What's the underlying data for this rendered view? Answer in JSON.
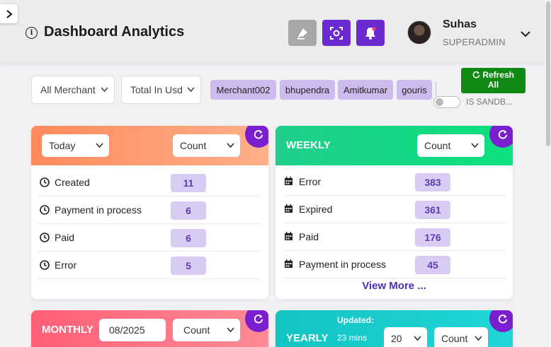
{
  "header": {
    "title": "Dashboard Analytics",
    "user_name": "Suhas",
    "user_role": "SUPERADMIN"
  },
  "filters": {
    "merchant_select": "All Merchant",
    "currency_select": "Total In Usd",
    "chips": [
      "Merchant002",
      "bhupendra",
      "Amitkumar",
      "gouris"
    ],
    "refresh_all_line1": "Refresh",
    "refresh_all_line2": "All",
    "sandbox_label": "IS SANDB..."
  },
  "cards": {
    "today": {
      "period_select": "Today",
      "metric_select": "Count",
      "rows": [
        {
          "label": "Created",
          "count": "11"
        },
        {
          "label": "Payment in process",
          "count": "6"
        },
        {
          "label": "Paid",
          "count": "6"
        },
        {
          "label": "Error",
          "count": "5"
        }
      ]
    },
    "weekly": {
      "title": "WEEKLY",
      "metric_select": "Count",
      "rows": [
        {
          "label": "Error",
          "count": "383"
        },
        {
          "label": "Expired",
          "count": "361"
        },
        {
          "label": "Paid",
          "count": "176"
        },
        {
          "label": "Payment in process",
          "count": "45"
        }
      ],
      "view_more": "View More ..."
    },
    "monthly": {
      "title": "MONTHLY",
      "month_input": "08/2025",
      "metric_select": "Count"
    },
    "yearly": {
      "title": "YEARLY",
      "updated_label": "Updated:",
      "updated_value": "23 mins",
      "year_select": "20",
      "metric_select": "Count"
    }
  },
  "colors": {
    "accent_purple": "#6a2ad0",
    "refresh_green": "#0f8a12",
    "chip_bg": "#cdbbee",
    "count_bg": "#d9ccf4",
    "today_header": "#ff8a5c",
    "weekly_header": "#1ecf8a",
    "monthly_header": "#ff5e78",
    "yearly_header": "#12c4c4"
  },
  "icons": {
    "sidebar_toggle": "chevron-right-icon",
    "info": "info-icon",
    "brush": "brush-icon",
    "scan": "scan-icon",
    "bell": "bell-icon",
    "refresh": "refresh-icon",
    "clock": "clock-icon",
    "calendar": "calendar-icon"
  }
}
